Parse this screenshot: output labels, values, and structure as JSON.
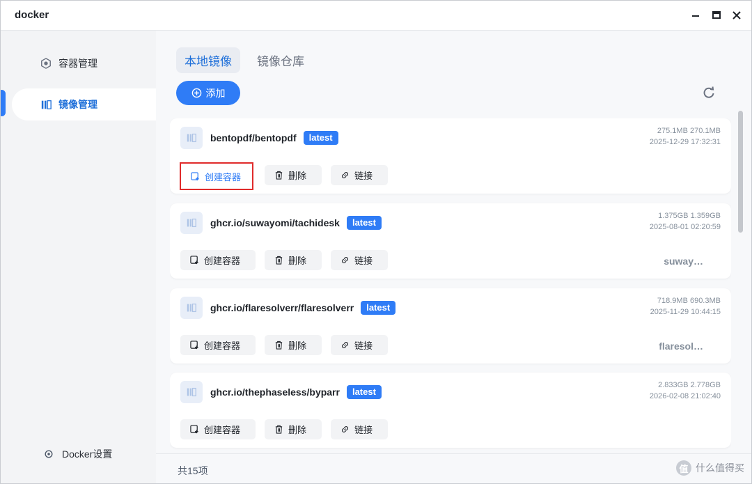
{
  "window": {
    "title": "docker"
  },
  "sidebar": {
    "items": [
      {
        "label": "容器管理",
        "icon": "hexagon-icon"
      },
      {
        "label": "镜像管理",
        "icon": "image-icon"
      }
    ],
    "settings_label": "Docker设置"
  },
  "tabs": [
    {
      "label": "本地镜像"
    },
    {
      "label": "镜像仓库"
    }
  ],
  "toolbar": {
    "add_label": "添加"
  },
  "images": [
    {
      "name": "bentopdf/bentopdf",
      "tag": "latest",
      "size": "275.1MB 270.1MB",
      "date": "2025-12-29 17:32:31",
      "short": "",
      "create_label": "创建容器",
      "delete_label": "删除",
      "link_label": "链接"
    },
    {
      "name": "ghcr.io/suwayomi/tachidesk",
      "tag": "latest",
      "size": "1.375GB 1.359GB",
      "date": "2025-08-01 02:20:59",
      "short": "suway…",
      "create_label": "创建容器",
      "delete_label": "删除",
      "link_label": "链接"
    },
    {
      "name": "ghcr.io/flaresolverr/flaresolverr",
      "tag": "latest",
      "size": "718.9MB 690.3MB",
      "date": "2025-11-29 10:44:15",
      "short": "flaresol…",
      "create_label": "创建容器",
      "delete_label": "删除",
      "link_label": "链接"
    },
    {
      "name": "ghcr.io/thephaseless/byparr",
      "tag": "latest",
      "size": "2.833GB 2.778GB",
      "date": "2026-02-08 21:02:40",
      "short": "",
      "create_label": "创建容器",
      "delete_label": "删除",
      "link_label": "链接"
    }
  ],
  "footer": {
    "count": "共15项",
    "watermark": "什么值得买",
    "watermark_badge": "值"
  },
  "colors": {
    "accent": "#2f7cf6",
    "highlight_border": "#e02b2b"
  }
}
